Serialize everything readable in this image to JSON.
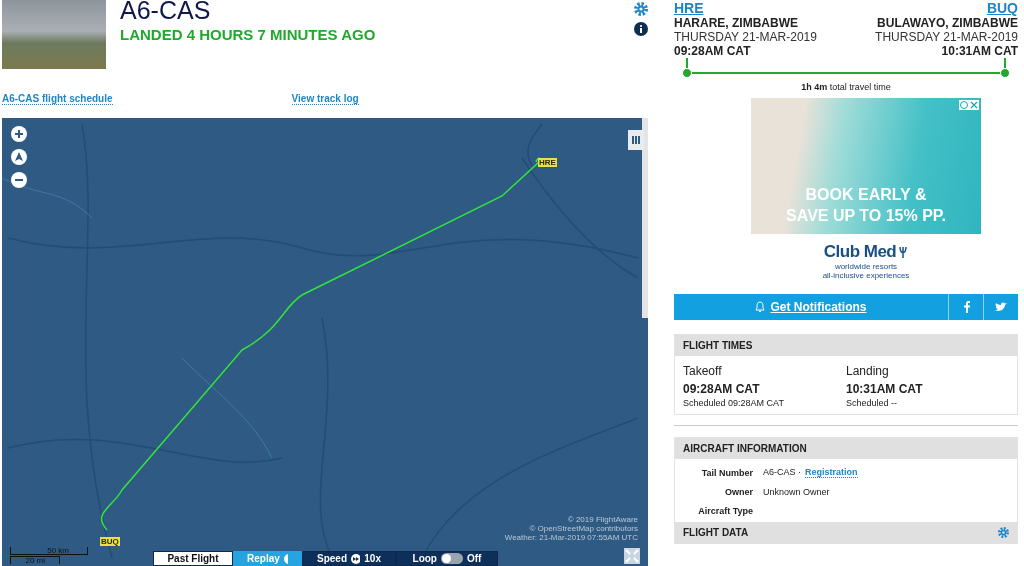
{
  "header": {
    "registration": "A6-CAS",
    "status": "LANDED 4 HOURS 7 MINUTES AGO"
  },
  "links": [
    "A6-CAS flight schedule",
    "View track log"
  ],
  "map": {
    "origin_label": "HRE",
    "destination_label": "BUQ",
    "scale_km": "50 km",
    "scale_mi": "20 mi",
    "attribution": [
      "© 2019 FlightAware",
      "© OpenStreetMap contributors",
      "Weather: 21-Mar-2019 07:55AM UTC"
    ],
    "playback": {
      "tab": "Past Flight",
      "replay": "Replay",
      "speed_label": "Speed",
      "speed_value": "10x",
      "loop_label": "Loop",
      "loop_on": false,
      "loop_state": "Off"
    }
  },
  "route": {
    "origin": {
      "code": "HRE",
      "city": "HARARE, ZIMBABWE",
      "date": "THURSDAY 21-MAR-2019",
      "time": "09:28AM CAT"
    },
    "destination": {
      "code": "BUQ",
      "city": "BULAWAYO, ZIMBABWE",
      "date": "THURSDAY 21-MAR-2019",
      "time": "10:31AM CAT"
    },
    "duration": "1h 4m",
    "duration_suffix": "total travel time"
  },
  "ad": {
    "headline": [
      "BOOK EARLY &",
      "SAVE UP TO 15% PP."
    ],
    "brand": "Club Med",
    "tagline": [
      "worldwide resorts",
      "all-inclusive experiences"
    ]
  },
  "notifications": {
    "label": "Get Notifications"
  },
  "flight_times": {
    "title": "FLIGHT TIMES",
    "columns": [
      {
        "label": "Takeoff",
        "time": "09:28AM CAT",
        "scheduled": "Scheduled 09:28AM CAT"
      },
      {
        "label": "Landing",
        "time": "10:31AM CAT",
        "scheduled": "Scheduled --"
      }
    ]
  },
  "aircraft_information": {
    "title": "AIRCRAFT INFORMATION",
    "rows": [
      {
        "label": "Tail Number",
        "value": "A6-CAS ·",
        "link": "Registration"
      },
      {
        "label": "Owner",
        "value": "Unknown Owner"
      },
      {
        "label": "Aircraft Type"
      }
    ]
  },
  "flight_data": {
    "title": "FLIGHT DATA"
  }
}
